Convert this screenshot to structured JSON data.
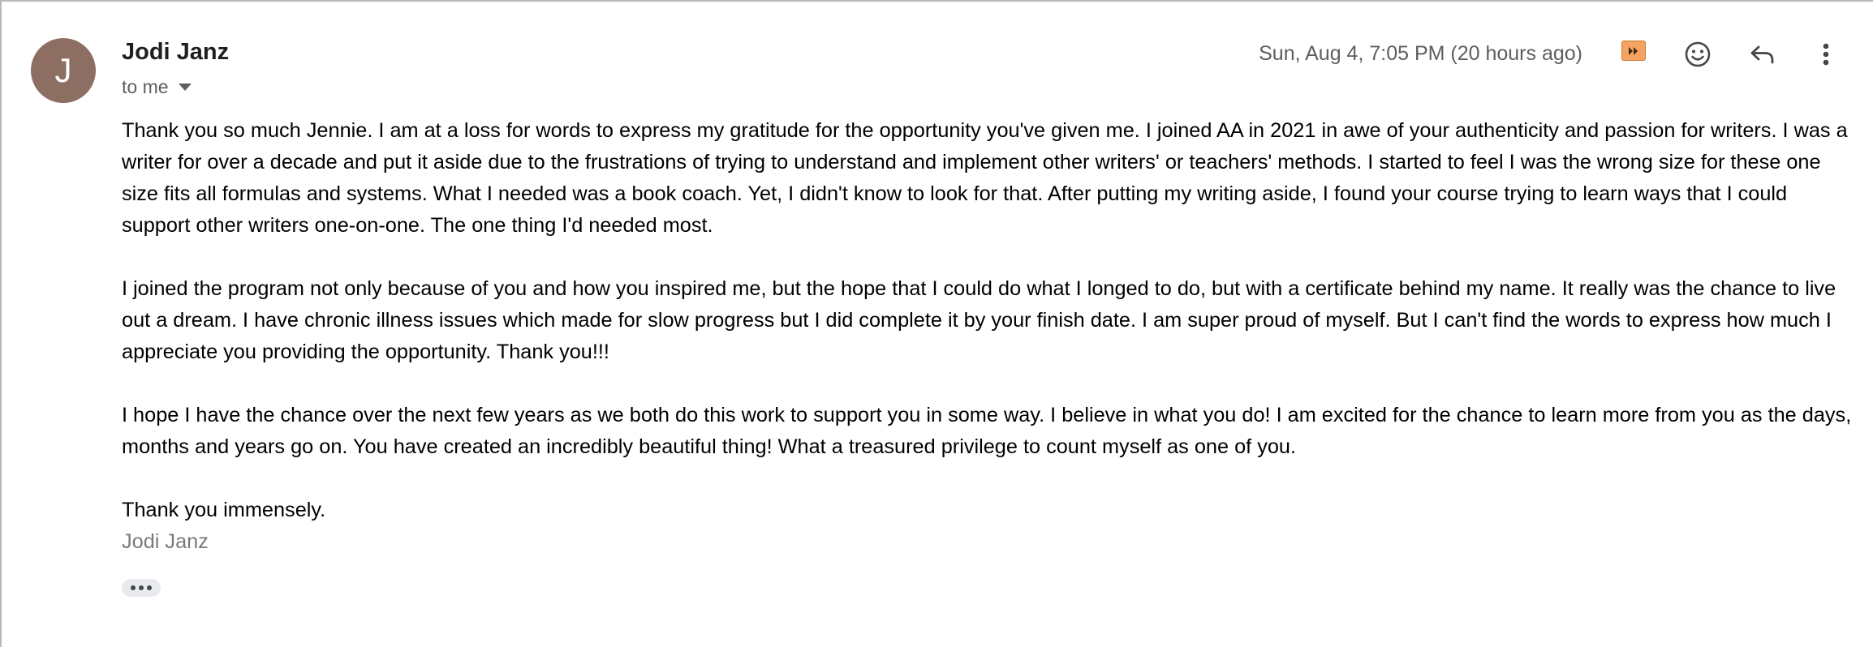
{
  "sender": {
    "initial": "J",
    "name": "Jodi Janz",
    "avatar_color": "#8d6e63"
  },
  "recipients_label": "to me",
  "date": "Sun, Aug 4, 7:05 PM (20 hours ago)",
  "icons": {
    "importance": "importance-marker-icon",
    "emoji": "emoji-reaction-icon",
    "reply": "reply-icon",
    "more": "more-vert-icon"
  },
  "colors": {
    "importance": "#f4a460"
  },
  "body": {
    "paragraphs": [
      "Thank you so much Jennie. I am at a loss for words to express my gratitude for the opportunity you've given me. I joined AA in 2021 in awe of your authenticity and passion for writers. I was a writer for over a decade and put it aside due to the frustrations of trying to understand and implement other writers' or teachers' methods. I started to feel I was the wrong size for these one size fits all formulas and systems. What I needed was a book coach. Yet, I didn't know to look for that. After putting my writing aside, I found your course trying to learn ways that I could support other writers one-on-one. The one thing I'd needed most.",
      "I joined the program not only because of you and how you inspired me, but the hope that I could do what I longed to do, but with a certificate behind my name. It really was the chance to live out a dream. I have chronic illness issues which made for slow progress but I did complete it by your finish date. I am super proud of myself. But I can't find the words to express how much I appreciate you providing the opportunity. Thank you!!!",
      "I hope I have the chance over the next few years as we both do this work to support you in some way. I believe in what you do! I am excited for the chance to learn more from you as the days, months and years go on. You have created an incredibly beautiful thing! What a treasured privilege to count myself as one of you."
    ],
    "closing": "Thank you immensely.",
    "signature": "Jodi Janz"
  }
}
